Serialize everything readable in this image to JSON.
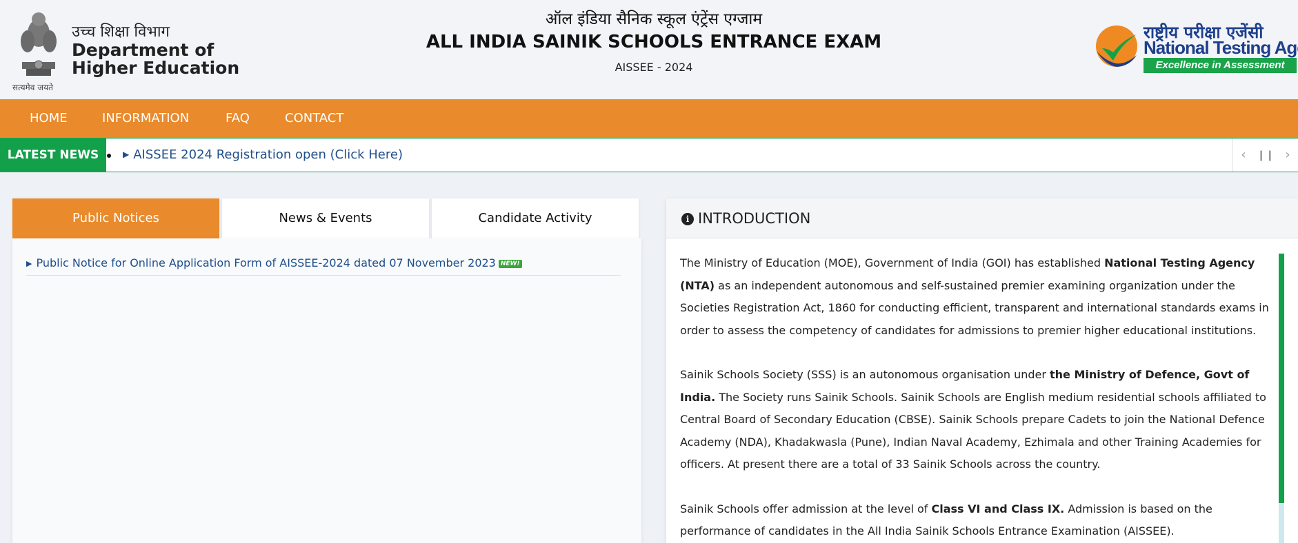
{
  "header": {
    "dept_hindi": "उच्च शिक्षा विभाग",
    "dept_title": "Department of Higher Education",
    "emblem_motto": "सत्यमेव जयते",
    "title_hindi": "ऑल इंडिया सैनिक स्कूल एंट्रेंस एग्जाम",
    "title_main": "ALL INDIA SAINIK SCHOOLS ENTRANCE EXAM",
    "title_sub": "AISSEE - 2024",
    "nta_hindi": "राष्ट्रीय परीक्षा एजेंसी",
    "nta_name": "National Testing Agency",
    "nta_tagline": "Excellence in Assessment"
  },
  "nav": {
    "items": [
      "HOME",
      "INFORMATION",
      "FAQ",
      "CONTACT"
    ]
  },
  "news": {
    "label": "LATEST NEWS",
    "item": "AISSEE 2024 Registration open (Click Here)",
    "controls": [
      "prev-icon",
      "pause-icon",
      "next-icon"
    ]
  },
  "tabs": [
    {
      "label": "Public Notices",
      "active": true
    },
    {
      "label": "News & Events",
      "active": false
    },
    {
      "label": "Candidate Activity",
      "active": false
    }
  ],
  "notices": [
    {
      "text": "Public Notice for Online Application Form of AISSEE-2024 dated 07 November 2023",
      "badge": "NEW!"
    }
  ],
  "intro": {
    "title": "INTRODUCTION",
    "icon": "info-circle-icon",
    "p1_a": "The Ministry of Education (MOE), Government of India (GOI) has established ",
    "p1_b": "National Testing Agency (NTA)",
    "p1_c": " as an independent autonomous and self-sustained premier examining organization under the Societies Registration Act, 1860 for conducting efficient, transparent and international standards exams in order to assess the competency of candidates for admissions to premier higher educational institutions.",
    "p2_a": "Sainik Schools Society (SSS) is an autonomous organisation under ",
    "p2_b": "the Ministry of Defence, Govt of India.",
    "p2_c": " The Society runs Sainik Schools. Sainik Schools are English medium residential schools affiliated to Central Board of Secondary Education (CBSE). Sainik Schools prepare Cadets to join the National Defence Academy (NDA), Khadakwasla (Pune), Indian Naval Academy, Ezhimala and other Training Academies for officers. At present there are a total of 33 Sainik Schools across the country.",
    "p3_a": "Sainik Schools offer admission at the level of ",
    "p3_b": "Class VI and Class IX.",
    "p3_c": " Admission is based on the performance of candidates in the All India Sainik Schools Entrance Examination (AISSEE)."
  },
  "colors": {
    "orange": "#e98a2c",
    "green": "#12a04b",
    "link_blue": "#1f4e8c",
    "nta_blue": "#1e3f8c"
  }
}
